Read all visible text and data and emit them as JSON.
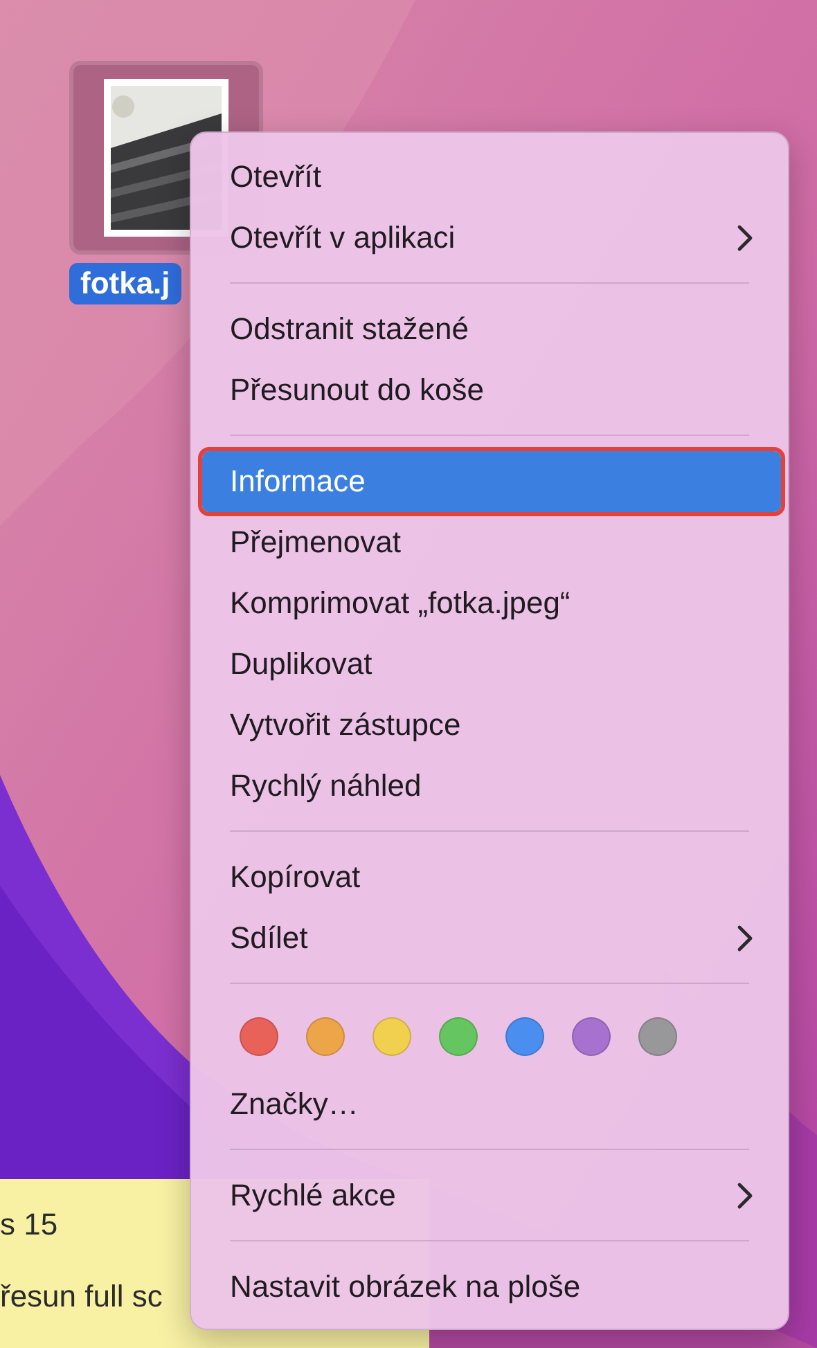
{
  "desktop": {
    "file": {
      "name": "fotka.j",
      "selected": true
    }
  },
  "sticky_note": {
    "lines": [
      "s 15",
      "řesun full sc"
    ]
  },
  "context_menu": {
    "sections": [
      {
        "items": [
          {
            "kind": "item",
            "label": "Otevřít",
            "submenu": false,
            "selected": false
          },
          {
            "kind": "item",
            "label": "Otevřít v aplikaci",
            "submenu": true,
            "selected": false
          }
        ]
      },
      {
        "items": [
          {
            "kind": "item",
            "label": "Odstranit stažené",
            "submenu": false,
            "selected": false
          },
          {
            "kind": "item",
            "label": "Přesunout do koše",
            "submenu": false,
            "selected": false
          }
        ]
      },
      {
        "items": [
          {
            "kind": "item",
            "label": "Informace",
            "submenu": false,
            "selected": true
          },
          {
            "kind": "item",
            "label": "Přejmenovat",
            "submenu": false,
            "selected": false
          },
          {
            "kind": "item",
            "label": "Komprimovat „fotka.jpeg“",
            "submenu": false,
            "selected": false
          },
          {
            "kind": "item",
            "label": "Duplikovat",
            "submenu": false,
            "selected": false
          },
          {
            "kind": "item",
            "label": "Vytvořit zástupce",
            "submenu": false,
            "selected": false
          },
          {
            "kind": "item",
            "label": "Rychlý náhled",
            "submenu": false,
            "selected": false
          }
        ]
      },
      {
        "items": [
          {
            "kind": "item",
            "label": "Kopírovat",
            "submenu": false,
            "selected": false
          },
          {
            "kind": "item",
            "label": "Sdílet",
            "submenu": true,
            "selected": false
          }
        ]
      },
      {
        "items": [
          {
            "kind": "tags",
            "tags": [
              {
                "color": "#e8625a"
              },
              {
                "color": "#eda54a"
              },
              {
                "color": "#f0d04e"
              },
              {
                "color": "#65c560"
              },
              {
                "color": "#4a8ef0"
              },
              {
                "color": "#a772cf"
              },
              {
                "color": "#98979a"
              }
            ]
          },
          {
            "kind": "item",
            "label": "Značky…",
            "submenu": false,
            "selected": false
          }
        ]
      },
      {
        "items": [
          {
            "kind": "item",
            "label": "Rychlé akce",
            "submenu": true,
            "selected": false
          }
        ]
      },
      {
        "items": [
          {
            "kind": "item",
            "label": "Nastavit obrázek na ploše",
            "submenu": false,
            "selected": false
          }
        ]
      }
    ]
  }
}
